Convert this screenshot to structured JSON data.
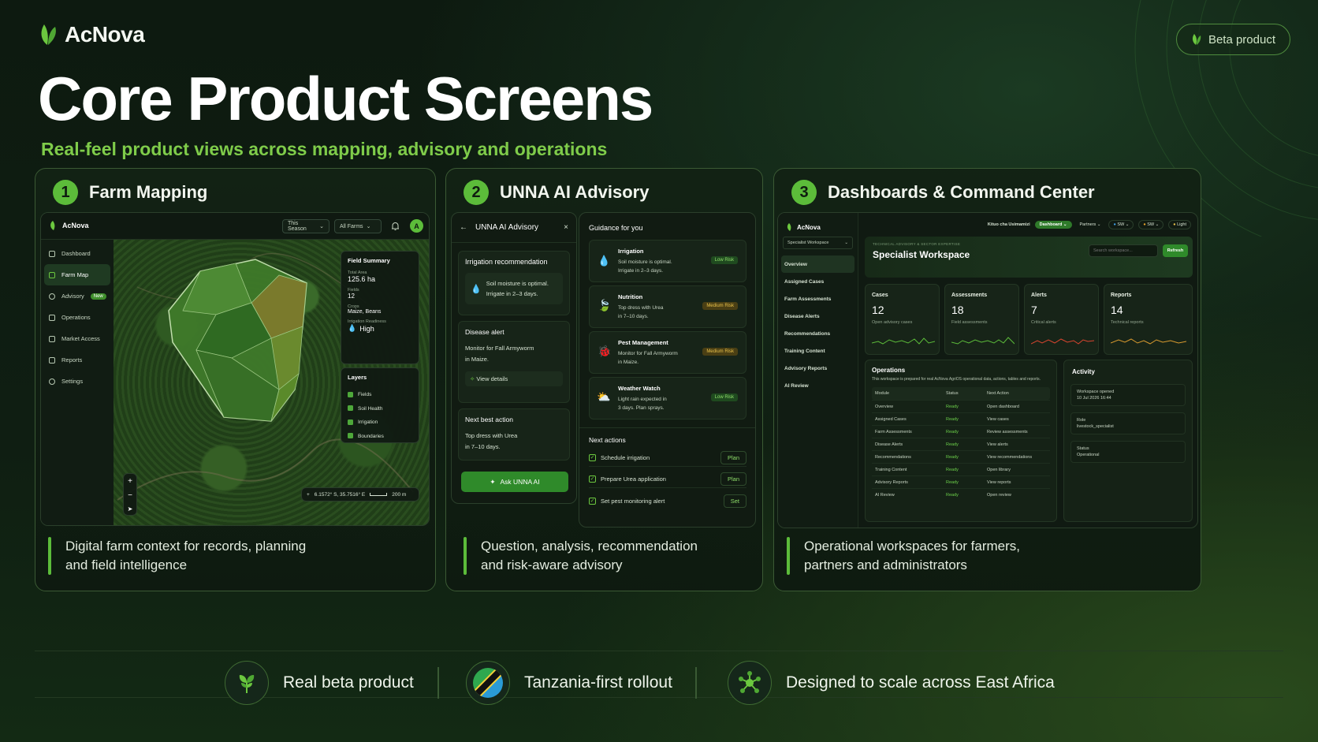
{
  "brand": {
    "name": "AcNova",
    "beta_label": "Beta product"
  },
  "hero": {
    "title": "Core Product Screens",
    "subtitle": "Real-feel product views across mapping, advisory and operations"
  },
  "cards": [
    {
      "number": "1",
      "title": "Farm Mapping",
      "caption": "Digital farm context for records, planning and field intelligence"
    },
    {
      "number": "2",
      "title": "UNNA AI Advisory",
      "caption": "Question, analysis, recommendation and risk-aware advisory"
    },
    {
      "number": "3",
      "title": "Dashboards & Command Center",
      "caption": "Operational workspaces for farmers, partners and administrators"
    }
  ],
  "farm_map": {
    "app_name": "AcNova",
    "season_select": "This Season",
    "farms_select": "All Farms",
    "avatar": "A",
    "nav": [
      {
        "label": "Dashboard"
      },
      {
        "label": "Farm Map"
      },
      {
        "label": "Advisory",
        "badge": "New"
      },
      {
        "label": "Operations"
      },
      {
        "label": "Market Access"
      },
      {
        "label": "Reports"
      },
      {
        "label": "Settings"
      }
    ],
    "summary": {
      "title": "Field Summary",
      "total_area_label": "Total Area",
      "total_area": "125.6 ha",
      "fields_label": "Fields",
      "fields": "12",
      "crops_label": "Crops",
      "crops": "Maize, Beans",
      "irrigation_label": "Irrigation Readiness",
      "irrigation": "High"
    },
    "layers": {
      "title": "Layers",
      "items": [
        "Fields",
        "Soil Health",
        "Irrigation",
        "Boundaries"
      ]
    },
    "zoom_in": "+",
    "zoom_out": "−",
    "coords": "6.1572° S, 35.7516° E",
    "scale": "200 m"
  },
  "advisory": {
    "chat": {
      "title": "UNNA AI Advisory",
      "irrigation_title": "Irrigation recommendation",
      "irrigation_text_1": "Soil moisture is optimal.",
      "irrigation_text_2": "Irrigate in 2–3 days.",
      "disease_title": "Disease alert",
      "disease_text_1": "Monitor for Fall Armyworm",
      "disease_text_2": "in Maize.",
      "view_details": "View details",
      "next_title": "Next best action",
      "next_text_1": "Top dress with Urea",
      "next_text_2": "in 7–10 days.",
      "ask_button": "Ask UNNA AI"
    },
    "guidance": {
      "title": "Guidance for you",
      "items": [
        {
          "title": "Irrigation",
          "line1": "Soil moisture is optimal.",
          "line2": "Irrigate in 2–3 days.",
          "risk": "Low Risk",
          "level": "low"
        },
        {
          "title": "Nutrition",
          "line1": "Top dress with Urea",
          "line2": "in 7–10 days.",
          "risk": "Medium Risk",
          "level": "med"
        },
        {
          "title": "Pest Management",
          "line1": "Monitor for Fall Armyworm",
          "line2": "in Maize.",
          "risk": "Medium Risk",
          "level": "med"
        },
        {
          "title": "Weather Watch",
          "line1": "Light rain expected in",
          "line2": "3 days. Plan sprays.",
          "risk": "Low Risk",
          "level": "low"
        }
      ],
      "next_actions_title": "Next actions",
      "next_actions": [
        {
          "label": "Schedule irrigation",
          "button": "Plan"
        },
        {
          "label": "Prepare Urea application",
          "button": "Plan"
        },
        {
          "label": "Set pest monitoring alert",
          "button": "Set"
        }
      ]
    }
  },
  "dashboard": {
    "app_name": "AcNova",
    "workspace_select": "Specialist Workspace",
    "nav": [
      "Overview",
      "Assigned Cases",
      "Farm Assessments",
      "Disease Alerts",
      "Recommendations",
      "Training Content",
      "Advisory Reports",
      "AI Review"
    ],
    "top": {
      "user": "Kituo cha Usimamizi",
      "dashboard": "Dashboard",
      "partners": "Partners",
      "lang1": "SW",
      "lang2": "SW",
      "theme": "Light"
    },
    "eyebrow": "TECHNICAL ADVISORY & SECTOR EXPERTISE",
    "heading": "Specialist Workspace",
    "search_placeholder": "Search workspace...",
    "refresh": "Refresh",
    "stats": [
      {
        "label": "Cases",
        "value": "12",
        "sub": "Open advisory cases",
        "color": "#5cbc3a"
      },
      {
        "label": "Assessments",
        "value": "18",
        "sub": "Field assessments",
        "color": "#5cbc3a"
      },
      {
        "label": "Alerts",
        "value": "7",
        "sub": "Critical alerts",
        "color": "#d9452f"
      },
      {
        "label": "Reports",
        "value": "14",
        "sub": "Technical reports",
        "color": "#d99a2f"
      }
    ],
    "operations": {
      "title": "Operations",
      "desc": "This workspace is prepared for real AcNova AgriOS operational data, actions, tables and reports.",
      "headers": [
        "Module",
        "Status",
        "Next Action"
      ],
      "rows": [
        [
          "Overview",
          "Ready",
          "Open dashboard"
        ],
        [
          "Assigned Cases",
          "Ready",
          "View cases"
        ],
        [
          "Farm Assessments",
          "Ready",
          "Review assessments"
        ],
        [
          "Disease Alerts",
          "Ready",
          "View alerts"
        ],
        [
          "Recommendations",
          "Ready",
          "View recommendations"
        ],
        [
          "Training Content",
          "Ready",
          "Open library"
        ],
        [
          "Advisory Reports",
          "Ready",
          "View reports"
        ],
        [
          "AI Review",
          "Ready",
          "Open review"
        ]
      ]
    },
    "activity": {
      "title": "Activity",
      "items": [
        {
          "label": "Workspace opened",
          "value": "10 Jul 2026 16:44"
        },
        {
          "label": "Role",
          "value": "livestock_specialist"
        },
        {
          "label": "Status",
          "value": "Operational"
        }
      ]
    }
  },
  "features": [
    {
      "label": "Real beta product",
      "icon": "sprout-icon"
    },
    {
      "label": "Tanzania-first rollout",
      "icon": "tanzania-flag-icon"
    },
    {
      "label": "Designed to scale across East Africa",
      "icon": "network-icon"
    }
  ]
}
